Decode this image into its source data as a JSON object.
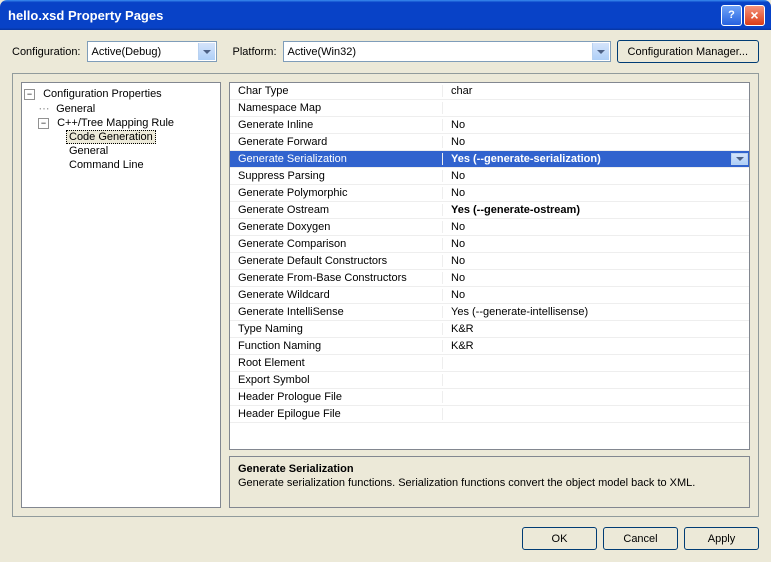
{
  "window": {
    "title": "hello.xsd Property Pages"
  },
  "top": {
    "config_label": "Configuration:",
    "config_value": "Active(Debug)",
    "platform_label": "Platform:",
    "platform_value": "Active(Win32)",
    "config_mgr": "Configuration Manager..."
  },
  "tree": {
    "root": "Configuration Properties",
    "items": [
      "General",
      "C++/Tree Mapping Rule"
    ],
    "sub": [
      "Code Generation",
      "General",
      "Command Line"
    ],
    "selected": "Code Generation"
  },
  "grid": [
    {
      "name": "Char Type",
      "value": "char",
      "bold": false
    },
    {
      "name": "Namespace Map",
      "value": "",
      "bold": false
    },
    {
      "name": "Generate Inline",
      "value": "No",
      "bold": false
    },
    {
      "name": "Generate Forward",
      "value": "No",
      "bold": false
    },
    {
      "name": "Generate Serialization",
      "value": "Yes (--generate-serialization)",
      "bold": true,
      "selected": true
    },
    {
      "name": "Suppress Parsing",
      "value": "No",
      "bold": false
    },
    {
      "name": "Generate Polymorphic",
      "value": "No",
      "bold": false
    },
    {
      "name": "Generate Ostream",
      "value": "Yes (--generate-ostream)",
      "bold": true
    },
    {
      "name": "Generate Doxygen",
      "value": "No",
      "bold": false
    },
    {
      "name": "Generate Comparison",
      "value": "No",
      "bold": false
    },
    {
      "name": "Generate Default Constructors",
      "value": "No",
      "bold": false
    },
    {
      "name": "Generate From-Base Constructors",
      "value": "No",
      "bold": false
    },
    {
      "name": "Generate Wildcard",
      "value": "No",
      "bold": false
    },
    {
      "name": "Generate IntelliSense",
      "value": "Yes (--generate-intellisense)",
      "bold": false
    },
    {
      "name": "Type Naming",
      "value": "K&R",
      "bold": false
    },
    {
      "name": "Function Naming",
      "value": "K&R",
      "bold": false
    },
    {
      "name": "Root Element",
      "value": "",
      "bold": false
    },
    {
      "name": "Export Symbol",
      "value": "",
      "bold": false
    },
    {
      "name": "Header Prologue File",
      "value": "",
      "bold": false
    },
    {
      "name": "Header Epilogue File",
      "value": "",
      "bold": false
    }
  ],
  "desc": {
    "title": "Generate Serialization",
    "text": "Generate serialization functions. Serialization functions convert the object model back to XML."
  },
  "buttons": {
    "ok": "OK",
    "cancel": "Cancel",
    "apply": "Apply"
  }
}
